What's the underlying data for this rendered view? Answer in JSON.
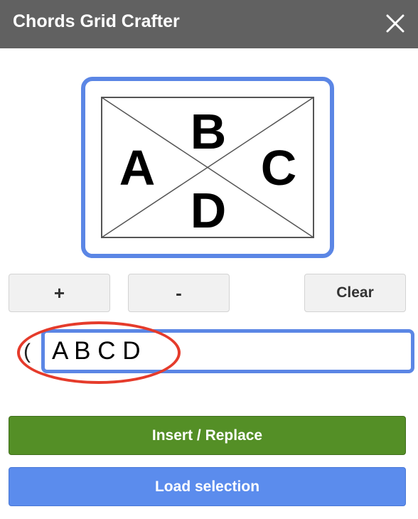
{
  "titlebar": {
    "title": "Chords Grid Crafter",
    "close_icon": "close-icon"
  },
  "grid": {
    "chords": {
      "left": "A",
      "top": "B",
      "right": "C",
      "bottom": "D"
    }
  },
  "controls": {
    "add_label": "+",
    "remove_label": "-",
    "clear_label": "Clear"
  },
  "chord_input": {
    "value": "A B C D",
    "placeholder": ""
  },
  "actions": {
    "insert_label": "Insert / Replace",
    "load_label": "Load selection"
  },
  "colors": {
    "titlebar": "#616161",
    "frame_blue": "#5b86e5",
    "insert_green": "#548f26",
    "load_blue": "#5b8ced",
    "annotation_red": "#e53b2b"
  }
}
